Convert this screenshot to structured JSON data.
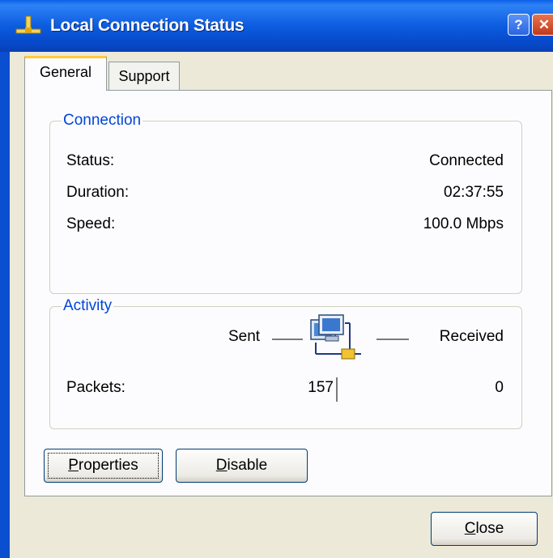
{
  "window": {
    "title": "Local Connection Status",
    "help_glyph": "?",
    "close_glyph": "✕",
    "icon": "network-connection-icon"
  },
  "tabs": [
    {
      "label": "General"
    },
    {
      "label": "Support"
    }
  ],
  "connection": {
    "group_title": "Connection",
    "status_label": "Status:",
    "status_value": "Connected",
    "duration_label": "Duration:",
    "duration_value": "02:37:55",
    "speed_label": "Speed:",
    "speed_value": "100.0 Mbps"
  },
  "activity": {
    "group_title": "Activity",
    "sent_label": "Sent",
    "received_label": "Received",
    "packets_label": "Packets:",
    "packets_sent": "157",
    "packets_received": "0",
    "icon": "network-computers-icon"
  },
  "buttons": {
    "properties": {
      "accel": "P",
      "rest": "roperties"
    },
    "disable": {
      "accel": "D",
      "rest": "isable"
    },
    "close": {
      "accel": "C",
      "rest": "lose"
    }
  }
}
